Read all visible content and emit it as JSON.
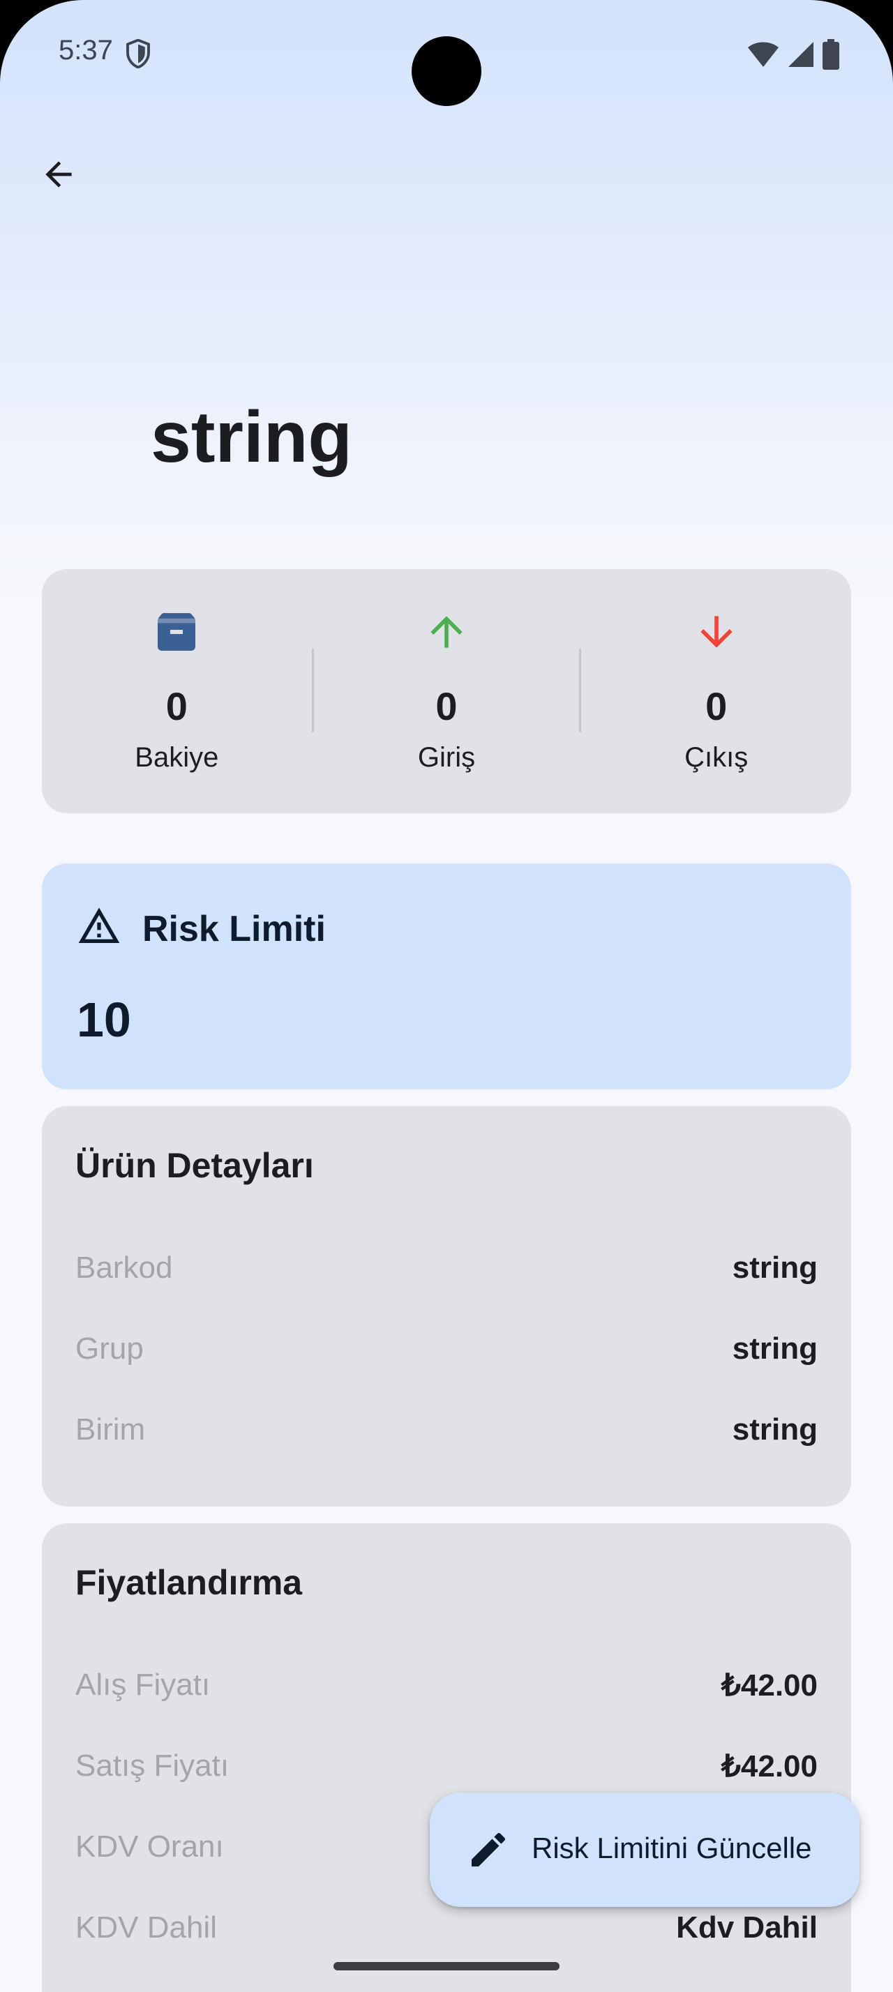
{
  "status_bar": {
    "time": "5:37"
  },
  "header": {
    "title": "string"
  },
  "stats": [
    {
      "icon": "archive-box-icon",
      "value": "0",
      "label": "Bakiye",
      "color": "#3a6094"
    },
    {
      "icon": "arrow-up-icon",
      "value": "0",
      "label": "Giriş",
      "color": "#4caf50"
    },
    {
      "icon": "arrow-down-icon",
      "value": "0",
      "label": "Çıkış",
      "color": "#f44336"
    }
  ],
  "risk": {
    "title": "Risk Limiti",
    "value": "10"
  },
  "details": {
    "title": "Ürün Detayları",
    "rows": [
      {
        "label": "Barkod",
        "value": "string"
      },
      {
        "label": "Grup",
        "value": "string"
      },
      {
        "label": "Birim",
        "value": "string"
      }
    ]
  },
  "pricing": {
    "title": "Fiyatlandırma",
    "rows": [
      {
        "label": "Alış Fiyatı",
        "value": "₺42.00"
      },
      {
        "label": "Satış Fiyatı",
        "value": "₺42.00"
      },
      {
        "label": "KDV Oranı",
        "value": ""
      },
      {
        "label": "KDV Dahil",
        "value": "Kdv Dahil"
      }
    ]
  },
  "fab": {
    "label": "Risk Limitini Güncelle"
  },
  "colors": {
    "accent_container": "#d1e3fc",
    "card_surface": "#e1e2e7"
  }
}
